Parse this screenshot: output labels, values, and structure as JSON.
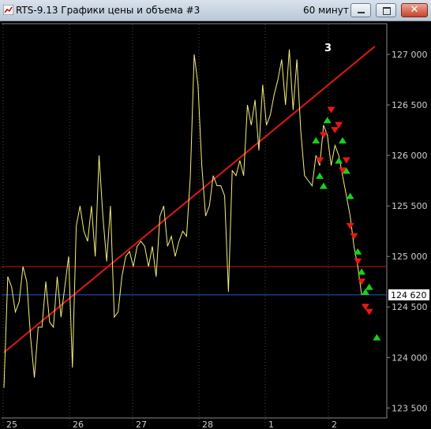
{
  "window": {
    "title": "RTS-9.13 Графики цены и объема #3",
    "period": "60 минут",
    "close_glyph": "✕"
  },
  "chart_data": {
    "type": "line",
    "y_ticks": [
      "127 000",
      "126 500",
      "126 000",
      "125 500",
      "125 000",
      "124 500",
      "124 000",
      "123 500"
    ],
    "y_tick_values": [
      127000,
      126500,
      126000,
      125500,
      125000,
      124500,
      124000,
      123500
    ],
    "ylim": [
      123500,
      127000
    ],
    "x_ticks": [
      "25",
      "26",
      "27",
      "28",
      "1",
      "2"
    ],
    "annotation": "3",
    "current_price_label": "124 620",
    "current_price": 124620,
    "support_level": 124900,
    "trend_line": {
      "start": {
        "x": 0,
        "y": 124050
      },
      "end": {
        "x": 100,
        "y": 127080
      }
    },
    "series": [
      {
        "values": [
          [
            0,
            123700
          ],
          [
            1,
            124800
          ],
          [
            2,
            124700
          ],
          [
            3,
            124450
          ],
          [
            4,
            124550
          ],
          [
            5,
            124900
          ],
          [
            6,
            124750
          ],
          [
            7,
            124200
          ],
          [
            8,
            123800
          ],
          [
            9,
            124300
          ],
          [
            10,
            124300
          ],
          [
            11,
            124750
          ],
          [
            12,
            124350
          ],
          [
            13,
            124300
          ],
          [
            14,
            124800
          ],
          [
            15,
            124400
          ],
          [
            16,
            124700
          ],
          [
            17,
            125000
          ],
          [
            18,
            123900
          ],
          [
            19,
            125300
          ],
          [
            20,
            125500
          ],
          [
            21,
            125250
          ],
          [
            22,
            125150
          ],
          [
            23,
            125500
          ],
          [
            24,
            125000
          ],
          [
            25,
            126000
          ],
          [
            26,
            125400
          ],
          [
            27,
            124950
          ],
          [
            28,
            125500
          ],
          [
            29,
            124400
          ],
          [
            30,
            124450
          ],
          [
            31,
            124800
          ],
          [
            32,
            125000
          ],
          [
            33,
            125050
          ],
          [
            34,
            124900
          ],
          [
            35,
            125100
          ],
          [
            36,
            125150
          ],
          [
            37,
            125100
          ],
          [
            38,
            124900
          ],
          [
            39,
            125100
          ],
          [
            40,
            124800
          ],
          [
            41,
            125400
          ],
          [
            42,
            125500
          ],
          [
            43,
            125100
          ],
          [
            44,
            125200
          ],
          [
            45,
            125000
          ],
          [
            46,
            125150
          ],
          [
            47,
            125250
          ],
          [
            48,
            125200
          ],
          [
            49,
            125800
          ],
          [
            50,
            127000
          ],
          [
            51,
            126700
          ],
          [
            52,
            125900
          ],
          [
            53,
            125400
          ],
          [
            54,
            125500
          ],
          [
            55,
            125800
          ],
          [
            56,
            125700
          ],
          [
            57,
            125700
          ],
          [
            58,
            125600
          ],
          [
            59,
            124650
          ],
          [
            60,
            125850
          ],
          [
            61,
            125800
          ],
          [
            62,
            125950
          ],
          [
            63,
            125800
          ],
          [
            64,
            126500
          ],
          [
            65,
            126300
          ],
          [
            66,
            126550
          ],
          [
            67,
            126050
          ],
          [
            68,
            126700
          ],
          [
            69,
            126300
          ],
          [
            70,
            126400
          ],
          [
            71,
            126600
          ],
          [
            72,
            126750
          ],
          [
            73,
            126950
          ],
          [
            74,
            126500
          ],
          [
            75,
            127050
          ],
          [
            76,
            126450
          ],
          [
            77,
            126950
          ],
          [
            78,
            126250
          ],
          [
            79,
            125800
          ],
          [
            80,
            125750
          ],
          [
            81,
            125700
          ],
          [
            82,
            126000
          ],
          [
            83,
            125900
          ],
          [
            84,
            126300
          ],
          [
            85,
            126200
          ],
          [
            86,
            125900
          ],
          [
            87,
            126100
          ],
          [
            88,
            126000
          ],
          [
            89,
            125800
          ],
          [
            90,
            125600
          ],
          [
            91,
            125400
          ],
          [
            92,
            125100
          ],
          [
            93,
            124900
          ],
          [
            94,
            124620
          ]
        ]
      }
    ],
    "buy_signals": [
      [
        82,
        126150
      ],
      [
        83,
        125800
      ],
      [
        84,
        125700
      ],
      [
        85,
        126350
      ],
      [
        88,
        125950
      ],
      [
        89,
        126150
      ],
      [
        90,
        125850
      ],
      [
        91,
        125600
      ],
      [
        93,
        125050
      ],
      [
        94,
        124850
      ],
      [
        95,
        124650
      ],
      [
        96,
        124700
      ],
      [
        98,
        124200
      ]
    ],
    "sell_signals": [
      [
        83,
        125950
      ],
      [
        84,
        126200
      ],
      [
        86,
        126450
      ],
      [
        87,
        126250
      ],
      [
        88,
        126300
      ],
      [
        89,
        125850
      ],
      [
        90,
        125950
      ],
      [
        91,
        125300
      ],
      [
        92,
        125200
      ],
      [
        93,
        124950
      ],
      [
        94,
        124750
      ],
      [
        95,
        124500
      ],
      [
        96,
        124450
      ]
    ]
  }
}
